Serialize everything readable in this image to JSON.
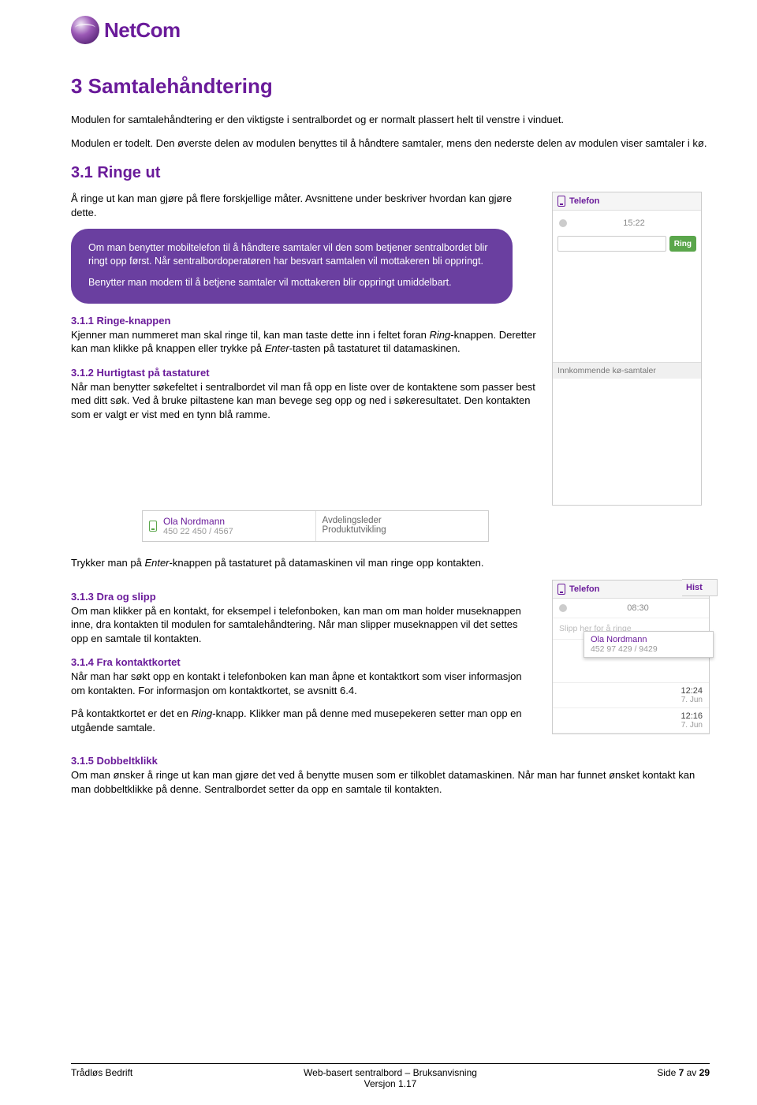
{
  "brand": {
    "name": "NetCom"
  },
  "heading": "3 Samtalehåndtering",
  "intro_p1": "Modulen for samtalehåndtering er den viktigste i sentralbordet og er normalt plassert helt til venstre i vinduet.",
  "intro_p2": "Modulen er todelt. Den øverste delen av modulen benyttes til å håndtere samtaler, mens den nederste delen av modulen viser samtaler i kø.",
  "sec31": {
    "title": "3.1 Ringe ut",
    "p": "Å ringe ut kan man gjøre på flere forskjellige måter. Avsnittene under beskriver hvordan kan gjøre dette."
  },
  "callout": {
    "p1": "Om man benytter mobiltelefon til å håndtere samtaler vil den som betjener sentralbordet blir ringt opp først. Når sentralbordoperatøren har besvart samtalen vil mottakeren bli oppringt.",
    "p2": "Benytter man modem til å betjene samtaler vil mottakeren blir oppringt umiddelbart."
  },
  "widget1": {
    "header": "Telefon",
    "time": "15:22",
    "ring_label": "Ring",
    "incoming_label": "Innkommende kø-samtaler"
  },
  "s311": {
    "title": "3.1.1    Ringe-knappen",
    "body_a": "Kjenner man nummeret man skal ringe til, kan man taste dette inn i feltet foran ",
    "body_b": "Ring",
    "body_c": "-knappen. Deretter kan man klikke på knappen eller trykke på ",
    "body_d": "Enter",
    "body_e": "-tasten på tastaturet til datamaskinen."
  },
  "s312": {
    "title": "3.1.2    Hurtigtast på tastaturet",
    "body": "Når man benytter søkefeltet i sentralbordet vil man få opp en liste over de kontaktene som passer best med ditt søk. Ved å bruke piltastene kan man bevege seg opp og ned i søkeresultatet. Den kontakten som er valgt er vist med en tynn blå ramme."
  },
  "contact": {
    "name": "Ola Nordmann",
    "number": "450 22 450 / 4567",
    "role1": "Avdelingsleder",
    "role2": "Produktutvikling"
  },
  "after_contact_a": "Trykker man på ",
  "after_contact_b": "Enter",
  "after_contact_c": "-knappen på tastaturet på datamaskinen vil man ringe opp kontakten.",
  "s313": {
    "title": "3.1.3    Dra og slipp",
    "body": "Om man klikker på en kontakt, for eksempel i telefonboken, kan man om man holder museknappen inne, dra kontakten til modulen for samtalehåndtering. Når man slipper museknappen vil det settes opp en samtale til kontakten."
  },
  "s314": {
    "title": "3.1.4    Fra kontaktkortet",
    "body1": "Når man har søkt opp en kontakt i telefonboken kan man åpne et kontaktkort som viser informasjon om kontakten. For informasjon om kontaktkortet, se avsnitt 6.4.",
    "body2_a": "På kontaktkortet er det en ",
    "body2_b": "Ring",
    "body2_c": "-knapp. Klikker man på denne med musepekeren setter man opp en utgående samtale."
  },
  "widget2": {
    "header": "Telefon",
    "hist": "Hist",
    "time": "08:30",
    "ghost": "Slipp her for å ringe",
    "drag_name": "Ola Nordmann",
    "drag_num": "452 97 429 / 9429",
    "entries": [
      {
        "tm": "12:24",
        "dt": "7. Jun"
      },
      {
        "tm": "12:16",
        "dt": "7. Jun"
      }
    ]
  },
  "s315": {
    "title": "3.1.5    Dobbeltklikk",
    "body": "Om man ønsker å ringe ut kan man gjøre det ved å benytte musen som er tilkoblet datamaskinen. Når man har funnet ønsket kontakt kan man dobbeltklikke på denne. Sentralbordet setter da opp en samtale til kontakten."
  },
  "footer": {
    "left": "Trådløs Bedrift",
    "center1": "Web-basert sentralbord – Bruksanvisning",
    "center2": "Versjon 1.17",
    "right_a": "Side ",
    "right_b": "7",
    "right_c": " av ",
    "right_d": "29"
  }
}
